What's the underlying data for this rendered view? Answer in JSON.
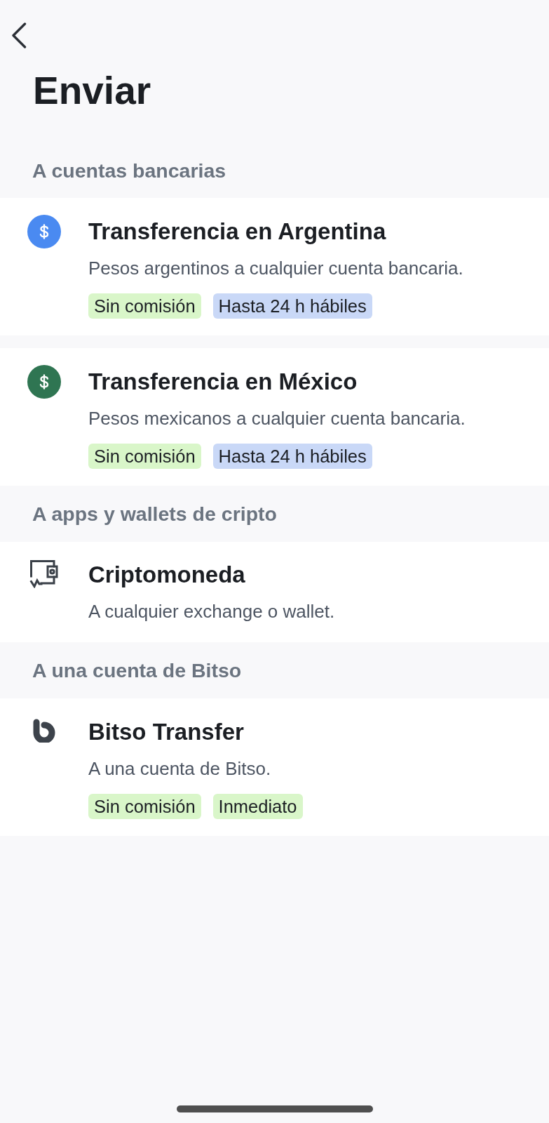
{
  "title": "Enviar",
  "sections": [
    {
      "heading": "A cuentas bancarias",
      "options": [
        {
          "kind": "dollar",
          "color": "#4a8af1",
          "title": "Transferencia en Argentina",
          "description": "Pesos argentinos a cualquier cuenta bancaria.",
          "tags": [
            {
              "label": "Sin comisión",
              "color": "#d9f6c9"
            },
            {
              "label": "Hasta 24 h hábiles",
              "color": "#c9d8f7"
            }
          ]
        },
        {
          "kind": "dollar",
          "color": "#2f7552",
          "title": "Transferencia en México",
          "description": "Pesos mexicanos a cualquier cuenta bancaria.",
          "tags": [
            {
              "label": "Sin comisión",
              "color": "#d9f6c9"
            },
            {
              "label": "Hasta 24 h hábiles",
              "color": "#c9d8f7"
            }
          ]
        }
      ]
    },
    {
      "heading": "A apps y wallets de cripto",
      "options": [
        {
          "kind": "wallet",
          "title": "Criptomoneda",
          "description": "A cualquier exchange o wallet."
        }
      ]
    },
    {
      "heading": "A una cuenta de Bitso",
      "options": [
        {
          "kind": "logo",
          "title": "Bitso Transfer",
          "description": "A una cuenta de Bitso.",
          "tags": [
            {
              "label": "Sin comisión",
              "color": "#d9f6c9"
            },
            {
              "label": "Inmediato",
              "color": "#d9f6c9"
            }
          ]
        }
      ]
    }
  ]
}
